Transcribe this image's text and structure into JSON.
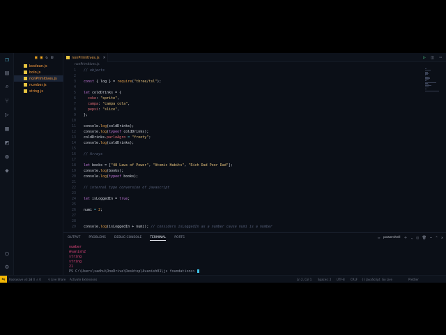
{
  "explorer": {
    "files": [
      {
        "name": "boolean.js"
      },
      {
        "name": "bolo.js"
      },
      {
        "name": "nonPrimitives.js",
        "active": true
      },
      {
        "name": "number.js"
      },
      {
        "name": "string.js"
      }
    ]
  },
  "editor": {
    "tab": {
      "label": "nonPrimitives.js"
    },
    "breadcrumb": "nonPrimitives.js",
    "lines": [
      {
        "n": "1",
        "tokens": [
          {
            "t": "// objects",
            "c": "cmt"
          }
        ]
      },
      {
        "n": "2",
        "tokens": []
      },
      {
        "n": "3",
        "tokens": [
          {
            "t": "const",
            "c": "kw"
          },
          {
            "t": " { log } = ",
            "c": "var"
          },
          {
            "t": "require",
            "c": "fn"
          },
          {
            "t": "(",
            "c": "var"
          },
          {
            "t": "\"three/tsl\"",
            "c": "str"
          },
          {
            "t": ");",
            "c": "var"
          }
        ]
      },
      {
        "n": "4",
        "tokens": []
      },
      {
        "n": "5",
        "tokens": [
          {
            "t": "let",
            "c": "kw"
          },
          {
            "t": " coldDrinks = {",
            "c": "var"
          }
        ]
      },
      {
        "n": "6",
        "tokens": [
          {
            "t": "  coke",
            "c": "prop"
          },
          {
            "t": ": ",
            "c": "var"
          },
          {
            "t": "\"sprite\"",
            "c": "str"
          },
          {
            "t": ",",
            "c": "var"
          }
        ]
      },
      {
        "n": "7",
        "tokens": [
          {
            "t": "  campa",
            "c": "prop"
          },
          {
            "t": ": ",
            "c": "var"
          },
          {
            "t": "\"campa cola\"",
            "c": "str"
          },
          {
            "t": ",",
            "c": "var"
          }
        ]
      },
      {
        "n": "8",
        "tokens": [
          {
            "t": "  pepsi",
            "c": "prop"
          },
          {
            "t": ": ",
            "c": "var"
          },
          {
            "t": "\"slice\"",
            "c": "str"
          },
          {
            "t": ",",
            "c": "var"
          }
        ]
      },
      {
        "n": "9",
        "tokens": [
          {
            "t": "};",
            "c": "var"
          }
        ]
      },
      {
        "n": "10",
        "tokens": []
      },
      {
        "n": "11",
        "tokens": [
          {
            "t": "console",
            "c": "var"
          },
          {
            "t": ".",
            "c": "var"
          },
          {
            "t": "log",
            "c": "fn"
          },
          {
            "t": "(coldDrinks);",
            "c": "var"
          }
        ]
      },
      {
        "n": "12",
        "tokens": [
          {
            "t": "console",
            "c": "var"
          },
          {
            "t": ".",
            "c": "var"
          },
          {
            "t": "log",
            "c": "fn"
          },
          {
            "t": "(",
            "c": "var"
          },
          {
            "t": "typeof",
            "c": "kw"
          },
          {
            "t": " coldDrinks);",
            "c": "var"
          }
        ]
      },
      {
        "n": "13",
        "tokens": [
          {
            "t": "coldDrinks",
            "c": "var"
          },
          {
            "t": ".",
            "c": "var"
          },
          {
            "t": "parleAgro",
            "c": "prop"
          },
          {
            "t": " = ",
            "c": "op"
          },
          {
            "t": "\"frooty\"",
            "c": "str"
          },
          {
            "t": ";",
            "c": "var"
          }
        ]
      },
      {
        "n": "14",
        "tokens": [
          {
            "t": "console",
            "c": "var"
          },
          {
            "t": ".",
            "c": "var"
          },
          {
            "t": "log",
            "c": "fn"
          },
          {
            "t": "(coldDrinks);",
            "c": "var"
          }
        ]
      },
      {
        "n": "15",
        "tokens": []
      },
      {
        "n": "16",
        "tokens": [
          {
            "t": "// Arrays",
            "c": "cmt"
          }
        ]
      },
      {
        "n": "17",
        "tokens": []
      },
      {
        "n": "18",
        "tokens": [
          {
            "t": "let",
            "c": "kw"
          },
          {
            "t": " books = [",
            "c": "var"
          },
          {
            "t": "\"48 Laws of Power\"",
            "c": "str"
          },
          {
            "t": ", ",
            "c": "var"
          },
          {
            "t": "\"Atomic Habits\"",
            "c": "str"
          },
          {
            "t": ", ",
            "c": "var"
          },
          {
            "t": "\"Rich Dad Poor Dad\"",
            "c": "str"
          },
          {
            "t": "];",
            "c": "var"
          }
        ]
      },
      {
        "n": "19",
        "tokens": [
          {
            "t": "console",
            "c": "var"
          },
          {
            "t": ".",
            "c": "var"
          },
          {
            "t": "log",
            "c": "fn"
          },
          {
            "t": "(books);",
            "c": "var"
          }
        ]
      },
      {
        "n": "20",
        "tokens": [
          {
            "t": "console",
            "c": "var"
          },
          {
            "t": ".",
            "c": "var"
          },
          {
            "t": "log",
            "c": "fn"
          },
          {
            "t": "(",
            "c": "var"
          },
          {
            "t": "typeof",
            "c": "kw"
          },
          {
            "t": " books);",
            "c": "var"
          }
        ]
      },
      {
        "n": "21",
        "tokens": []
      },
      {
        "n": "22",
        "tokens": [
          {
            "t": "// internal type conversion of javascript",
            "c": "cmt"
          }
        ]
      },
      {
        "n": "23",
        "tokens": []
      },
      {
        "n": "24",
        "tokens": [
          {
            "t": "let",
            "c": "kw"
          },
          {
            "t": " isLoggedIn = ",
            "c": "var"
          },
          {
            "t": "true",
            "c": "kw"
          },
          {
            "t": ";",
            "c": "var"
          }
        ]
      },
      {
        "n": "25",
        "tokens": []
      },
      {
        "n": "26",
        "tokens": [
          {
            "t": "numi",
            "c": "var"
          },
          {
            "t": " = ",
            "c": "op"
          },
          {
            "t": "2",
            "c": "fn"
          },
          {
            "t": ";",
            "c": "var"
          }
        ]
      },
      {
        "n": "27",
        "tokens": []
      },
      {
        "n": "28",
        "tokens": []
      },
      {
        "n": "29",
        "tokens": [
          {
            "t": "console",
            "c": "var"
          },
          {
            "t": ".",
            "c": "var"
          },
          {
            "t": "log",
            "c": "fn"
          },
          {
            "t": "(isLoggedIn + numi); ",
            "c": "var"
          },
          {
            "t": "// considers isLoggedIn as a number cause numi is a number",
            "c": "cmt"
          }
        ]
      }
    ]
  },
  "panel": {
    "tabs": [
      {
        "label": "OUTPUT"
      },
      {
        "label": "PROBLEMS"
      },
      {
        "label": "DEBUG CONSOLE"
      },
      {
        "label": "TERMINAL",
        "active": true
      },
      {
        "label": "PORTS"
      }
    ],
    "shell": "powershell",
    "output": [
      "number",
      "Avanish2",
      "string",
      "string",
      "21"
    ],
    "prompt": "PS C:\\Users\\sadhu\\OneDrive\\Desktop\\Avanish01\\js foundations>"
  },
  "statusbar": {
    "items": [
      {
        "label": "Rookwave v3.17"
      },
      {
        "label": "⊗ 0 ⚠ 0"
      },
      {
        "label": "⚲ Live Share"
      },
      {
        "label": "Activate Extensions"
      },
      {
        "label": "Ln 2, Col 1"
      },
      {
        "label": "Spaces: 2"
      },
      {
        "label": "UTF-8"
      },
      {
        "label": "CRLF"
      },
      {
        "label": "{} JavaScript"
      },
      {
        "label": "Go Live"
      },
      {
        "label": "Prettier"
      }
    ]
  },
  "colors": {
    "background": "#0b0f17",
    "accent": "#5ac8e6",
    "fileName": "#ff9e3d",
    "terminalText": "#e0457b",
    "remoteBadge": "#f2b705"
  }
}
